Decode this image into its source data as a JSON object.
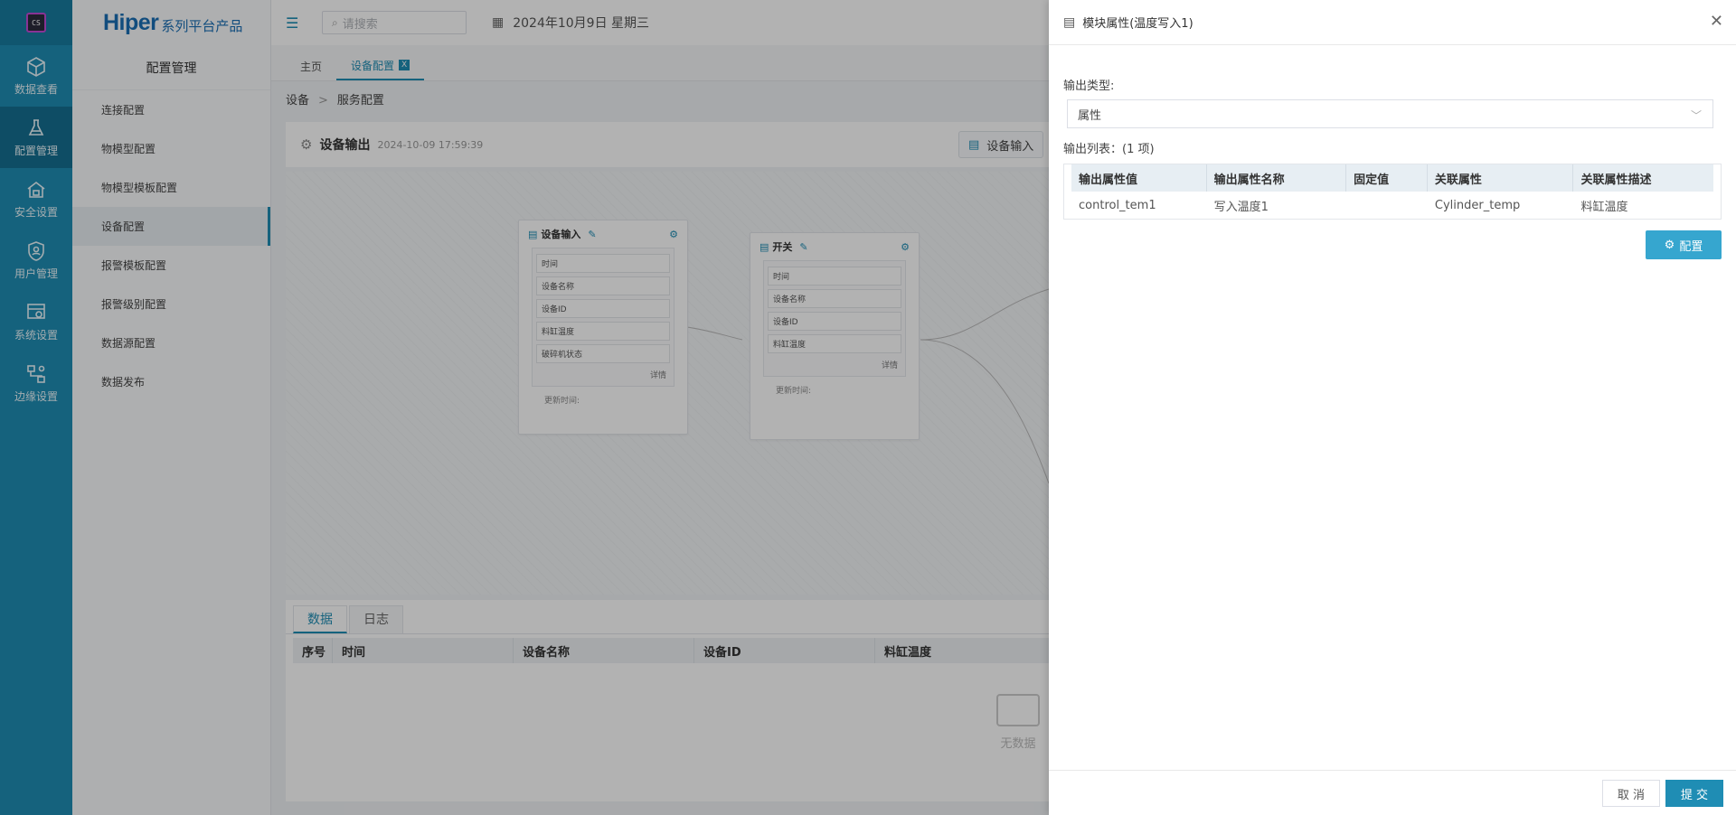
{
  "rail": {
    "logo_text": "CS",
    "items": [
      {
        "label": "数据查看",
        "icon": "cube-icon"
      },
      {
        "label": "配置管理",
        "icon": "flask-icon"
      },
      {
        "label": "安全设置",
        "icon": "home-lock-icon"
      },
      {
        "label": "用户管理",
        "icon": "shield-user-icon"
      },
      {
        "label": "系统设置",
        "icon": "system-gear-icon"
      },
      {
        "label": "边缘设置",
        "icon": "network-icon"
      }
    ]
  },
  "brand": {
    "main": "Hiper",
    "sub": "系列平台产品"
  },
  "subnav": {
    "title": "配置管理",
    "items": [
      "连接配置",
      "物模型配置",
      "物模型模板配置",
      "设备配置",
      "报警模板配置",
      "报警级别配置",
      "数据源配置",
      "数据发布"
    ]
  },
  "topbar": {
    "search_placeholder": "请搜索",
    "date": "2024年10月9日 星期三"
  },
  "tabs": [
    {
      "label": "主页"
    },
    {
      "label": "设备配置",
      "close": "X"
    }
  ],
  "breadcrumb": [
    "设备",
    "服务配置"
  ],
  "panel": {
    "title": "设备输出",
    "timestamp": "2024-10-09 17:59:39",
    "input_button": "设备输入"
  },
  "nodes": [
    {
      "title": "设备输入",
      "fields": [
        "时间",
        "设备名称",
        "设备ID",
        "料缸温度",
        "破碎机状态"
      ],
      "detail": "详情",
      "footer": "更新时间:"
    },
    {
      "title": "开关",
      "fields": [
        "时间",
        "设备名称",
        "设备ID",
        "料缸温度"
      ],
      "detail": "详情",
      "footer": "更新时间:"
    }
  ],
  "bottom": {
    "tabs": [
      "数据",
      "日志"
    ],
    "columns": [
      "序号",
      "时间",
      "设备名称",
      "设备ID",
      "料缸温度"
    ],
    "empty_text": "无数据"
  },
  "drawer": {
    "title": "模块属性(温度写入1)",
    "output_type_label": "输出类型:",
    "output_type_value": "属性",
    "output_list_label": "输出列表：(1 项)",
    "columns": [
      "输出属性值",
      "输出属性名称",
      "固定值",
      "关联属性",
      "关联属性描述"
    ],
    "rows": [
      [
        "control_tem1",
        "写入温度1",
        "",
        "Cylinder_temp",
        "料缸温度"
      ]
    ],
    "config_button": "配置",
    "cancel_button": "取 消",
    "submit_button": "提 交"
  },
  "colors": {
    "accent": "#1f8db4",
    "button": "#36a6cf"
  }
}
